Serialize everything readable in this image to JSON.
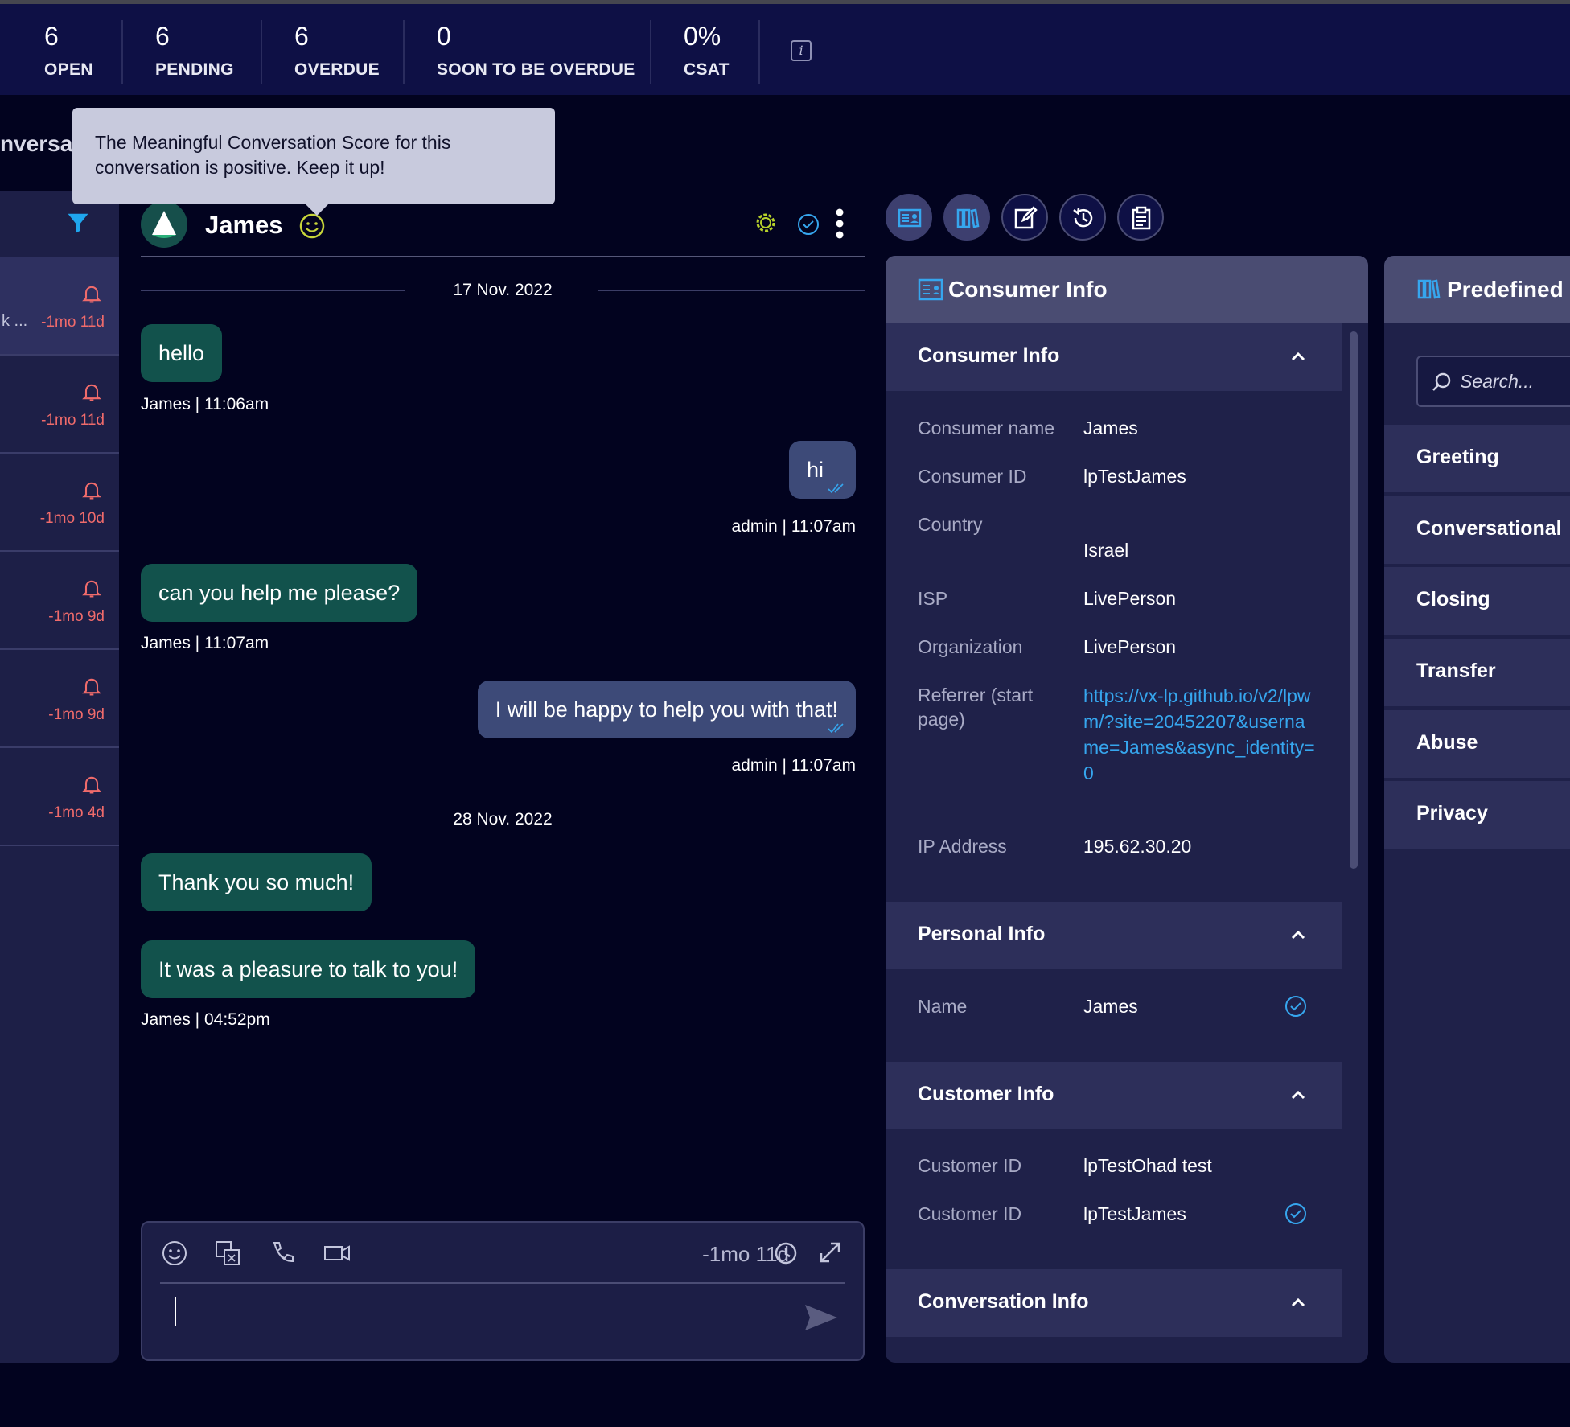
{
  "kpis": [
    {
      "value": "6",
      "label": "OPEN"
    },
    {
      "value": "6",
      "label": "PENDING"
    },
    {
      "value": "6",
      "label": "OVERDUE"
    },
    {
      "value": "0",
      "label": "SOON TO BE OVERDUE"
    },
    {
      "value": "0%",
      "label": "CSAT"
    }
  ],
  "left_heading": "nversati",
  "tooltip": "The Meaningful Conversation Score for this conversation is positive. Keep it up!",
  "conversation_list": [
    {
      "preview": "k ...",
      "time": "-1mo 11d"
    },
    {
      "preview": "",
      "time": "-1mo 11d"
    },
    {
      "preview": "",
      "time": "-1mo 10d"
    },
    {
      "preview": "",
      "time": "-1mo 9d"
    },
    {
      "preview": "",
      "time": "-1mo 9d"
    },
    {
      "preview": "",
      "time": "-1mo 4d"
    }
  ],
  "chat": {
    "name": "James",
    "dates": [
      "17 Nov. 2022",
      "28 Nov. 2022"
    ],
    "messages": [
      {
        "text": "hello",
        "meta": "James  |  11:06am"
      },
      {
        "text": "hi",
        "meta": "admin  |  11:07am"
      },
      {
        "text": "can you help me please?",
        "meta": "James  |  11:07am"
      },
      {
        "text": "I will be happy to help you with that!",
        "meta": "admin  |  11:07am"
      },
      {
        "text": "Thank you so much!",
        "meta": ""
      },
      {
        "text": "It was a pleasure to talk to you!",
        "meta": "James  |  04:52pm"
      }
    ]
  },
  "composer": {
    "timer": "-1mo 11d",
    "input_value": ""
  },
  "consumer_panel": {
    "title": "Consumer Info",
    "sections": {
      "consumer_info": {
        "title": "Consumer Info",
        "rows": [
          {
            "label": "Consumer name",
            "value": "James"
          },
          {
            "label": "Consumer ID",
            "value": "lpTestJames"
          },
          {
            "label": "Country",
            "value": "Israel"
          },
          {
            "label": "ISP",
            "value": "LivePerson"
          },
          {
            "label": "Organization",
            "value": "LivePerson"
          },
          {
            "label": "Referrer (start page)",
            "value": "https://vx-lp.github.io/v2/lpwm/?site=20452207&username=James&async_identity=0"
          },
          {
            "label": "IP Address",
            "value": "195.62.30.20"
          }
        ]
      },
      "personal_info": {
        "title": "Personal Info",
        "rows": [
          {
            "label": "Name",
            "value": "James"
          }
        ]
      },
      "customer_info": {
        "title": "Customer Info",
        "rows": [
          {
            "label": "Customer ID",
            "value": "lpTestOhad test"
          },
          {
            "label": "Customer ID",
            "value": "lpTestJames"
          }
        ]
      },
      "conversation_info": {
        "title": "Conversation Info"
      }
    }
  },
  "predefined_panel": {
    "title": "Predefined C",
    "search_placeholder": "Search...",
    "categories": [
      "Greeting",
      "Conversational",
      "Closing",
      "Transfer",
      "Abuse",
      "Privacy"
    ]
  },
  "colors": {
    "background": "#02031f",
    "kpi_bar": "#0e1045",
    "accent_blue": "#36a6ee",
    "alert_red": "#f06b6b",
    "inbound_bubble": "#12524c",
    "outbound_bubble": "#3d4a78",
    "mcs_positive": "#c7d53a"
  },
  "icons": {
    "filter": "filter-icon",
    "bell": "bell-icon",
    "mcs": "smiley-icon",
    "gear": "gear-icon",
    "check": "check-circle-icon",
    "more": "more-vertical-icon",
    "tabs": [
      "consumer-card-icon",
      "books-icon",
      "edit-icon",
      "history-icon",
      "clipboard-icon"
    ]
  }
}
